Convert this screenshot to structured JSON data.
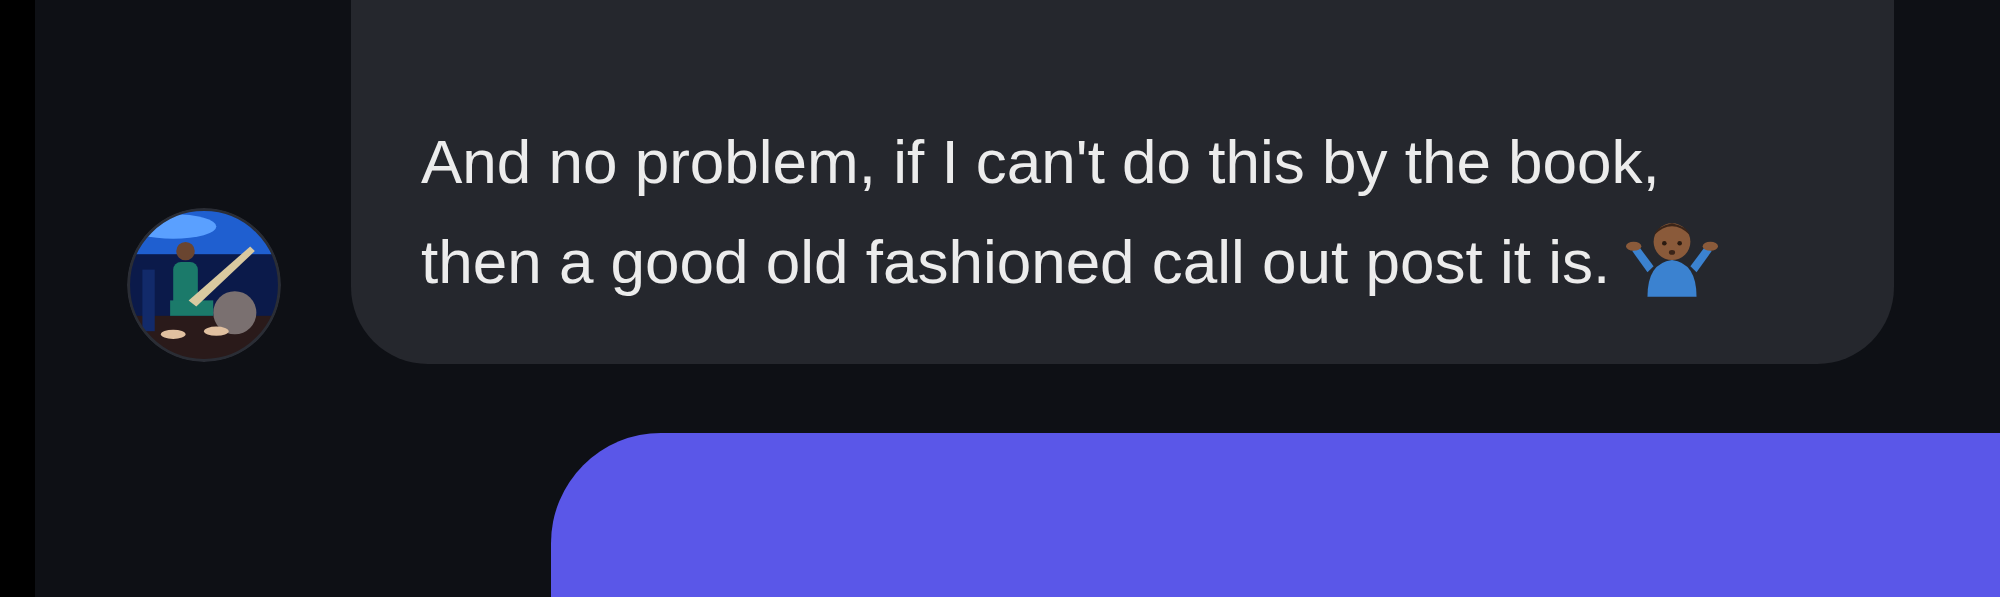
{
  "messages": [
    {
      "kind": "received",
      "text": "And no problem, if I can't do this by the book, then a good old fashioned call out post it is."
    },
    {
      "kind": "sent"
    }
  ]
}
